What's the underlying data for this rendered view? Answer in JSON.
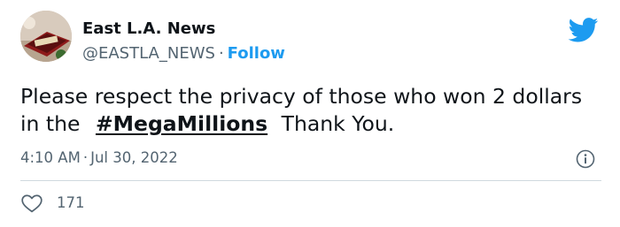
{
  "author": {
    "name": "East L.A. News",
    "handle": "@EASTLA_NEWS",
    "separator": "·",
    "follow_label": "Follow"
  },
  "tweet": {
    "text_before": "Please respect the privacy of those who won 2 dollars in the",
    "hashtag": "#MegaMillions",
    "text_after": "Thank You.",
    "time": "4:10 AM",
    "separator": "·",
    "date": "Jul 30, 2022"
  },
  "engagement": {
    "likes": "171"
  },
  "icons": {
    "brand": "twitter-bird-icon",
    "info": "info-icon",
    "like": "heart-icon"
  },
  "colors": {
    "accent": "#1d9bf0",
    "text_primary": "#0f1419",
    "text_secondary": "#536471",
    "divider": "#cfd9de"
  }
}
